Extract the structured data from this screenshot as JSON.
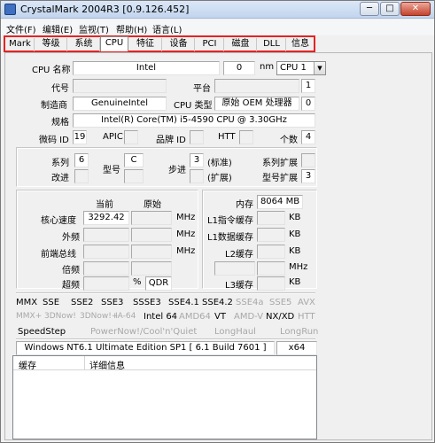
{
  "window": {
    "title": "CrystalMark 2004R3 [0.9.126.452]",
    "minimize_label": "─",
    "maximize_label": "□",
    "close_label": "✕"
  },
  "menu": [
    "文件(F)",
    "编辑(E)",
    "监视(T)",
    "帮助(H)",
    "语言(L)"
  ],
  "tabs": [
    "Mark",
    "等级",
    "系统",
    "CPU",
    "特征",
    "设备",
    "PCI",
    "磁盘",
    "DLL",
    "信息"
  ],
  "active_tab": "CPU",
  "cpu": {
    "name_label": "CPU 名称",
    "name_value": "Intel",
    "count_value": "0",
    "nm_label": "nm",
    "selector_value": "CPU 1",
    "codename_label": "代号",
    "platform_label": "平台",
    "platform_value": "1",
    "vendor_label": "制造商",
    "vendor_value": "GenuineIntel",
    "cpu_type_label": "CPU 类型",
    "cpu_type_value": "原始 OEM 处理器",
    "cpu_type_num": "0",
    "spec_label": "规格",
    "spec_value": "Intel(R) Core(TM) i5-4590 CPU @ 3.30GHz",
    "microcode_label": "微码 ID",
    "microcode_value": "19",
    "apic_label": "APIC",
    "brand_label": "品牌 ID",
    "htt_label": "HTT",
    "count_label": "个数",
    "count_num": "4"
  },
  "family": {
    "family_label": "系列",
    "family_value": "6",
    "model_label": "型号",
    "model_value": "C",
    "stepping_label": "步进",
    "stepping_value": "3",
    "standard_label": "(标准)",
    "extended_label": "(扩展)",
    "revision_label": "改进",
    "family_ext_label": "系列扩展",
    "model_ext_label": "型号扩展",
    "model_ext_value": "3"
  },
  "clocks": {
    "current_header": "当前",
    "original_header": "原始",
    "core_label": "核心速度",
    "core_value": "3292.42",
    "fsb_label": "外频",
    "bus_label": "前端总线",
    "mult_label": "倍频",
    "oc_label": "超频",
    "percent_label": "%",
    "qdr_label": "QDR",
    "mhz_unit": "MHz"
  },
  "memory": {
    "mem_label": "内存",
    "mem_value": "8064 MB",
    "l1i_label": "L1指令缓存",
    "l1d_label": "L1数据缓存",
    "l2_label": "L2缓存",
    "l3_label": "L3缓存",
    "kb_unit": "KB",
    "mhz_unit": "MHz"
  },
  "features": {
    "row1": [
      {
        "text": "MMX",
        "on": true
      },
      {
        "text": "SSE",
        "on": true
      },
      {
        "text": "SSE2",
        "on": true
      },
      {
        "text": "SSE3",
        "on": true
      },
      {
        "text": "SSSE3",
        "on": true
      },
      {
        "text": "SSE4.1",
        "on": true
      },
      {
        "text": "SSE4.2",
        "on": true
      },
      {
        "text": "SSE4a",
        "on": false
      },
      {
        "text": "SSE5",
        "on": false
      },
      {
        "text": "AVX",
        "on": false
      }
    ],
    "row2": [
      {
        "text": "MMX+",
        "on": false
      },
      {
        "text": "3DNow!",
        "on": false
      },
      {
        "text": "3DNow!+",
        "on": false
      },
      {
        "text": "IA-64",
        "on": false
      },
      {
        "text": "Intel 64",
        "on": true
      },
      {
        "text": "AMD64",
        "on": false
      },
      {
        "text": "VT",
        "on": true
      },
      {
        "text": "AMD-V",
        "on": false
      },
      {
        "text": "NX/XD",
        "on": true
      },
      {
        "text": "HTT",
        "on": false
      }
    ],
    "row3": [
      {
        "text": "SpeedStep",
        "on": true
      },
      {
        "text": "PowerNow!/Cool'n'Quiet",
        "on": false
      },
      {
        "text": "LongHaul",
        "on": false
      },
      {
        "text": "LongRun",
        "on": false
      }
    ]
  },
  "os": {
    "value": "Windows NT6.1 Ultimate Edition SP1 [ 6.1 Build 7601 ]",
    "arch": "x64"
  },
  "cache_list": {
    "col1": "缓存",
    "col2": "详细信息"
  }
}
